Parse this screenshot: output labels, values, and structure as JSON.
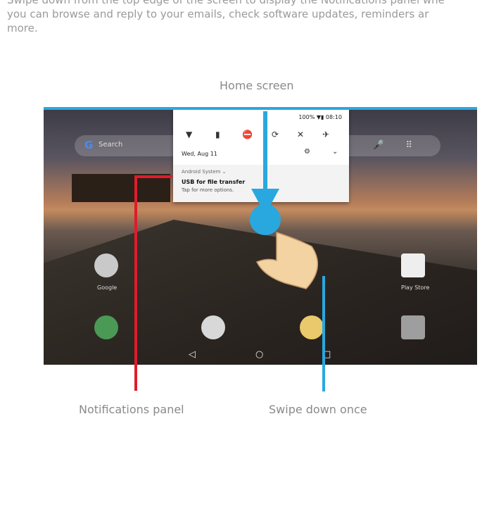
{
  "intro_text": "Swipe down from the top edge of the screen to display the Notifications panel whe\nyou can browse and reply to your emails, check software updates, reminders ar\nmore.",
  "captions": {
    "home_screen": "Home screen",
    "notifications_panel": "Notifications panel",
    "swipe_down": "Swipe down once"
  },
  "screen": {
    "search_placeholder": "Search",
    "apps": {
      "google": "Google",
      "play_store": "Play Store"
    },
    "panel": {
      "status": "100% ▼▮ 08:10",
      "date": "Wed, Aug 11",
      "notification": {
        "source": "Android System ⌄",
        "title": "USB for file transfer",
        "subtitle": "Tap for more options."
      }
    }
  },
  "colors": {
    "accent_blue": "#29a8e0",
    "accent_red": "#e01b2b"
  }
}
